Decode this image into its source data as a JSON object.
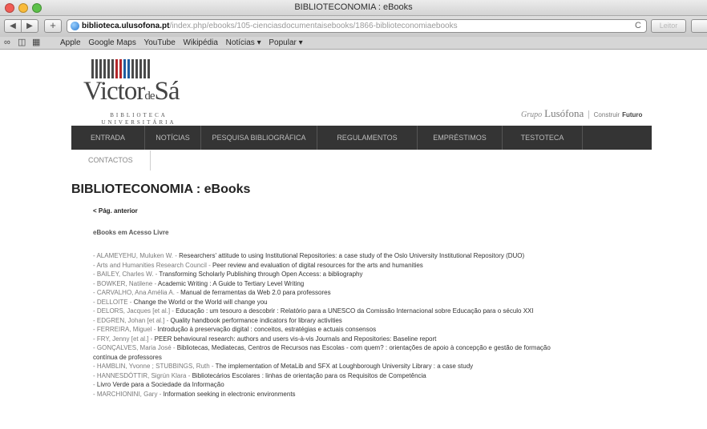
{
  "window": {
    "title": "BIBLIOTECONOMIA : eBooks"
  },
  "toolbar": {
    "back_label": "◀",
    "forward_label": "▶",
    "add_label": "+",
    "url_domain": "biblioteca.ulusofona.pt",
    "url_path": "/index.php/ebooks/105-cienciasdocumentaisebooks/1866-biblioteconomiaebooks",
    "reload_label": "C",
    "reader_label": "Leitor"
  },
  "bookmarks": {
    "items": [
      "Apple",
      "Google Maps",
      "YouTube",
      "Wikipédia",
      "Notícias ▾",
      "Popular ▾"
    ]
  },
  "site": {
    "logo_name_main": "Victor",
    "logo_name_de": "de",
    "logo_name_end": "Sá",
    "logo_line1": "BIBLIOTECA",
    "logo_line2": "UNIVERSITÁRIA",
    "grupo_prefix": "Grupo",
    "grupo_name": "Lusófona",
    "grupo_sep": "|",
    "grupo_construir": "Construir",
    "grupo_futuro": "Futuro"
  },
  "nav": {
    "items": [
      "ENTRADA",
      "NOTÍCIAS",
      "PESQUISA BIBLIOGRÁFICA",
      "REGULAMENTOS",
      "EMPRÉSTIMOS",
      "TESTOTECA"
    ],
    "sub_items": [
      "CONTACTOS"
    ]
  },
  "page": {
    "title": "BIBLIOTECONOMIA : eBooks",
    "prev_link": "< Pág. anterior",
    "section_heading": "eBooks em Acesso Livre"
  },
  "books": [
    {
      "author": "- ALAMEYEHU, Muluken W. - ",
      "title": "Researchers' attitude to using Institutional Repositories: a case study of the Oslo University Institutional Repository (DUO)"
    },
    {
      "author": "- Arts and Humanities Research Council - ",
      "title": "Peer review and evaluation of digital resources for the arts and humanities"
    },
    {
      "author": "- BAILEY, Charles W. - ",
      "title": "Transforming Scholarly Publishing through Open Access: a bibliography"
    },
    {
      "author": "- BOWKER, Natilene - ",
      "title": "Academic Writing : A Guide to Tertiary Level Writing"
    },
    {
      "author": "- CARVALHO, Ana Amélia A. - ",
      "title": "Manual de ferramentas da Web 2.0 para professores"
    },
    {
      "author": "- DELLOITE - ",
      "title": "Change the World or the World will change you"
    },
    {
      "author": "- DELORS, Jacques [et al.] - ",
      "title": "Educação : um tesouro a descobrir : Relatório para a UNESCO da Comissão Internacional sobre Educação para o século XXI"
    },
    {
      "author": "- EDGREN, Johan [et al.] - ",
      "title": "Quality handbook performance indicators for library activities"
    },
    {
      "author": "- FERREIRA, Miguel - ",
      "title": "Introdução à preservação digital : conceitos, estratégias e actuais consensos"
    },
    {
      "author": "- FRY, Jenny [et al.] - ",
      "title": "PEER behavioural research: authors and users vis-à-vis Journals and Repositories: Baseline report"
    },
    {
      "author": "- GONÇALVES, Maria José - ",
      "title": "Bibliotecas, Mediatecas, Centros de Recursos nas Escolas - com quem? : orientações de apoio à concepção e gestão de formação"
    },
    {
      "author": "",
      "title": "contínua de professores"
    },
    {
      "author": "- HAMBLIN, Yvonne ; STUBBINGS, Ruth - ",
      "title": "The implementation of MetaLib and SFX at Loughborough University Library : a case study"
    },
    {
      "author": "- HANNESDÓTTIR, Sigrún Klara - ",
      "title": "Bibliotecários Escolares : linhas de orientação para os Requisitos de Competência"
    },
    {
      "author": "- ",
      "title": "Livro Verde para a Sociedade da Informação"
    },
    {
      "author": "- MARCHIONINI, Gary - ",
      "title": "Information seeking in electronic environments"
    }
  ]
}
